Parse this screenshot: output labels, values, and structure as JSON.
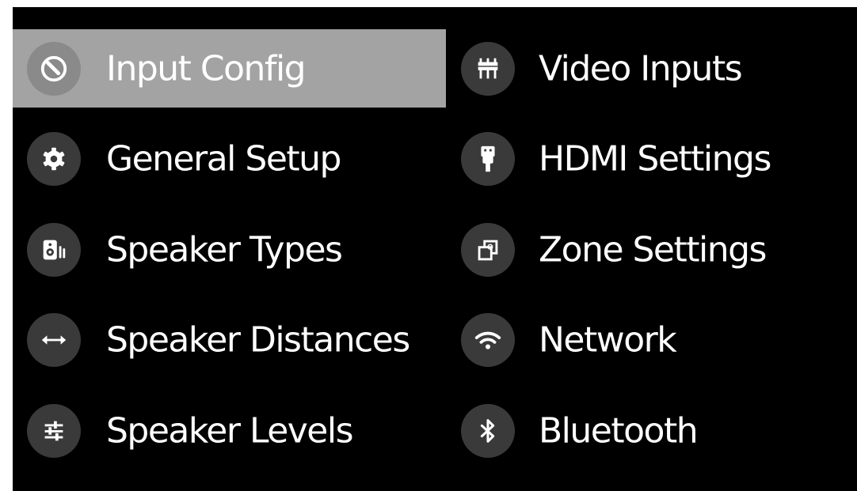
{
  "menu": {
    "left": [
      {
        "label": "Input Config",
        "icon": "input-config-icon",
        "selected": true
      },
      {
        "label": "General Setup",
        "icon": "gear-icon",
        "selected": false
      },
      {
        "label": "Speaker Types",
        "icon": "speaker-icon",
        "selected": false
      },
      {
        "label": "Speaker Distances",
        "icon": "double-arrow-icon",
        "selected": false
      },
      {
        "label": "Speaker Levels",
        "icon": "sliders-icon",
        "selected": false
      }
    ],
    "right": [
      {
        "label": "Video Inputs",
        "icon": "video-connectors-icon",
        "selected": false
      },
      {
        "label": "HDMI Settings",
        "icon": "hdmi-plug-icon",
        "selected": false
      },
      {
        "label": "Zone Settings",
        "icon": "zones-icon",
        "selected": false
      },
      {
        "label": "Network",
        "icon": "wifi-icon",
        "selected": false
      },
      {
        "label": "Bluetooth",
        "icon": "bluetooth-icon",
        "selected": false
      }
    ]
  },
  "colors": {
    "background": "#000000",
    "selected_background": "#a3a3a3",
    "icon_circle": "#3a3a3a",
    "text": "#ffffff"
  }
}
